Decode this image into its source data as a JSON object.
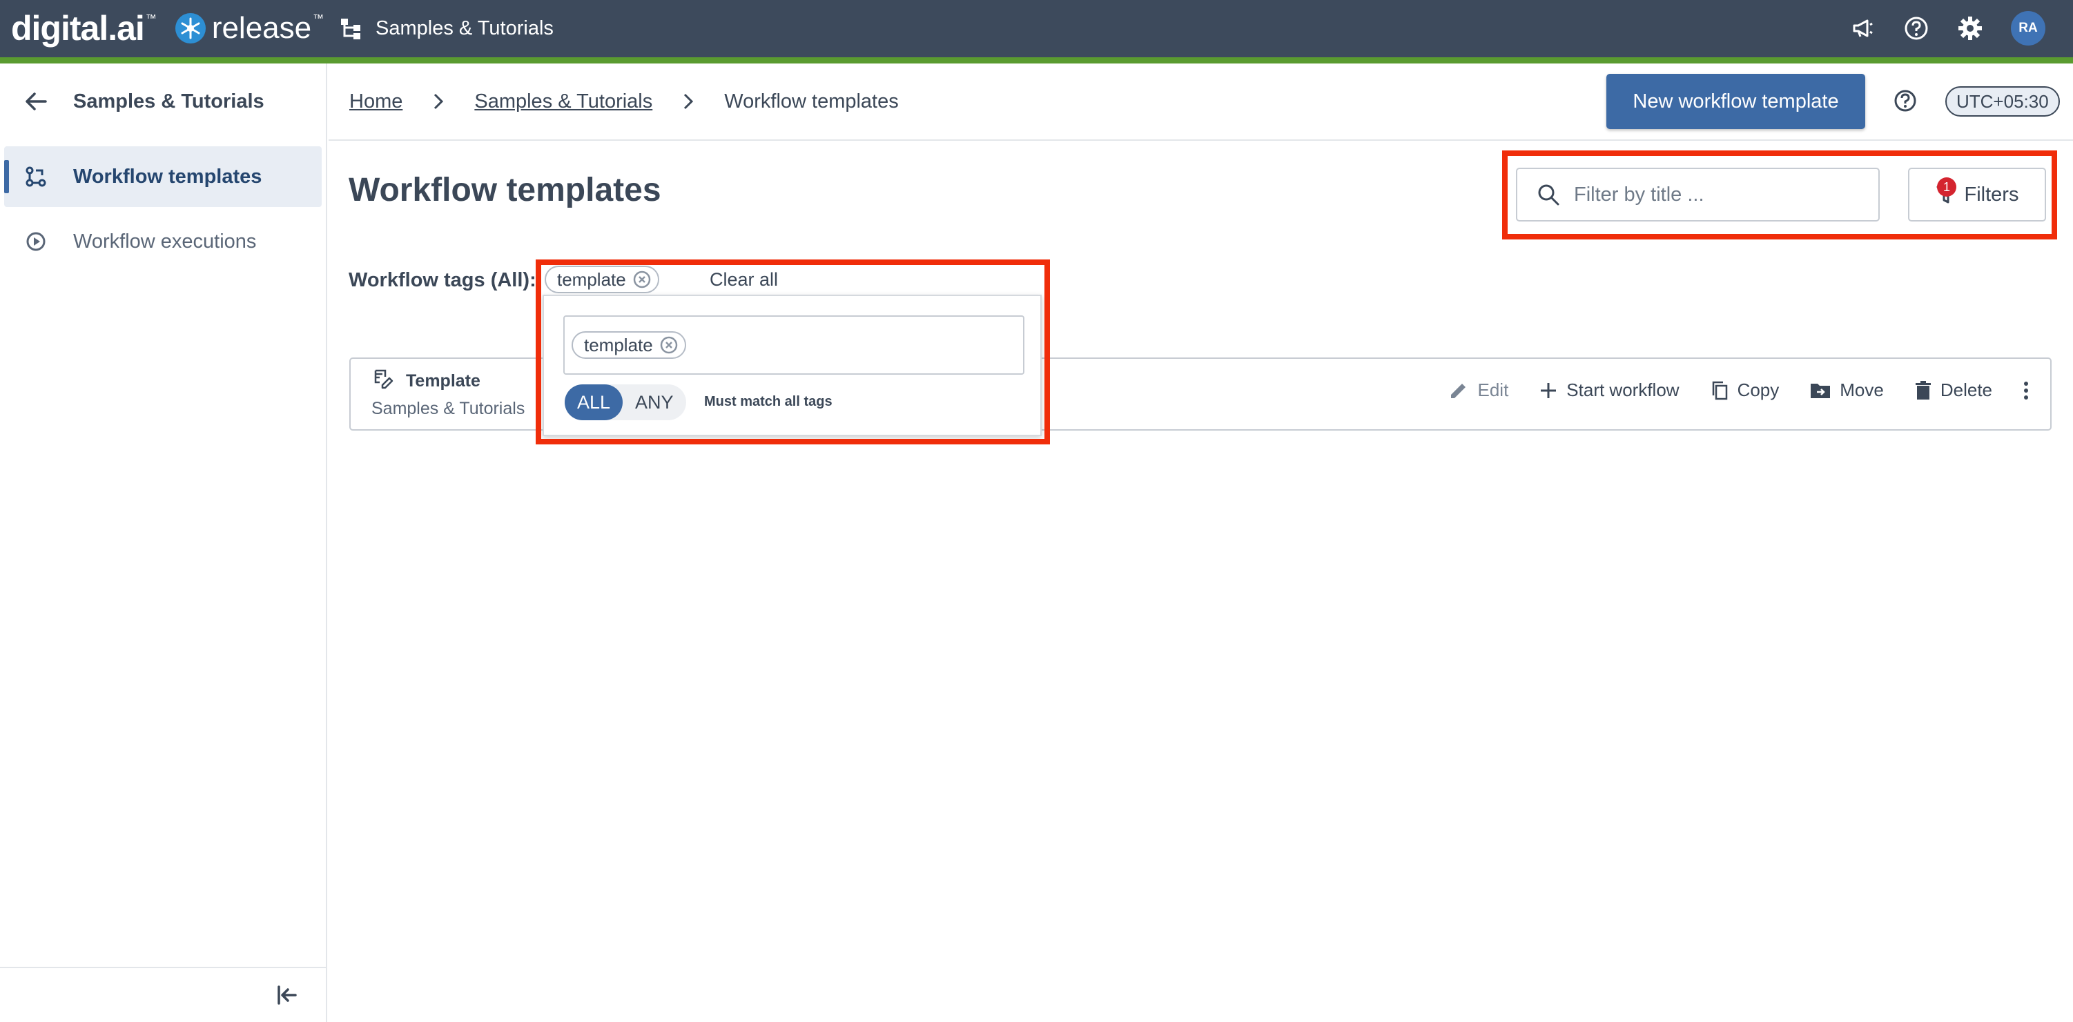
{
  "brand": {
    "company": "digital.ai",
    "product": "release"
  },
  "topnav": {
    "folder_label": "Samples & Tutorials",
    "avatar_initials": "RA"
  },
  "sidebar": {
    "title": "Samples & Tutorials",
    "items": [
      {
        "label": "Workflow templates",
        "active": true
      },
      {
        "label": "Workflow executions",
        "active": false
      }
    ]
  },
  "breadcrumb": {
    "home": "Home",
    "folder": "Samples & Tutorials",
    "current": "Workflow templates"
  },
  "header": {
    "new_button": "New workflow template",
    "timezone": "UTC+05:30"
  },
  "main": {
    "title": "Workflow templates",
    "search_placeholder": "Filter by title ...",
    "filters_label": "Filters",
    "filters_count": "1",
    "tags_label": "Workflow tags (All):",
    "active_tag": "template",
    "clear_all": "Clear all"
  },
  "popover": {
    "tag": "template",
    "match_all": "ALL",
    "match_any": "ANY",
    "match_mode": "ALL",
    "hint": "Must match all tags"
  },
  "card": {
    "title": "Template",
    "folder": "Samples & Tutorials",
    "actions": {
      "edit": "Edit",
      "start": "Start workflow",
      "copy": "Copy",
      "move": "Move",
      "delete": "Delete"
    }
  },
  "colors": {
    "nav_bg": "#3d4a5c",
    "accent_green": "#5a9b30",
    "primary": "#3d6aa5",
    "highlight": "#f02d0a"
  }
}
